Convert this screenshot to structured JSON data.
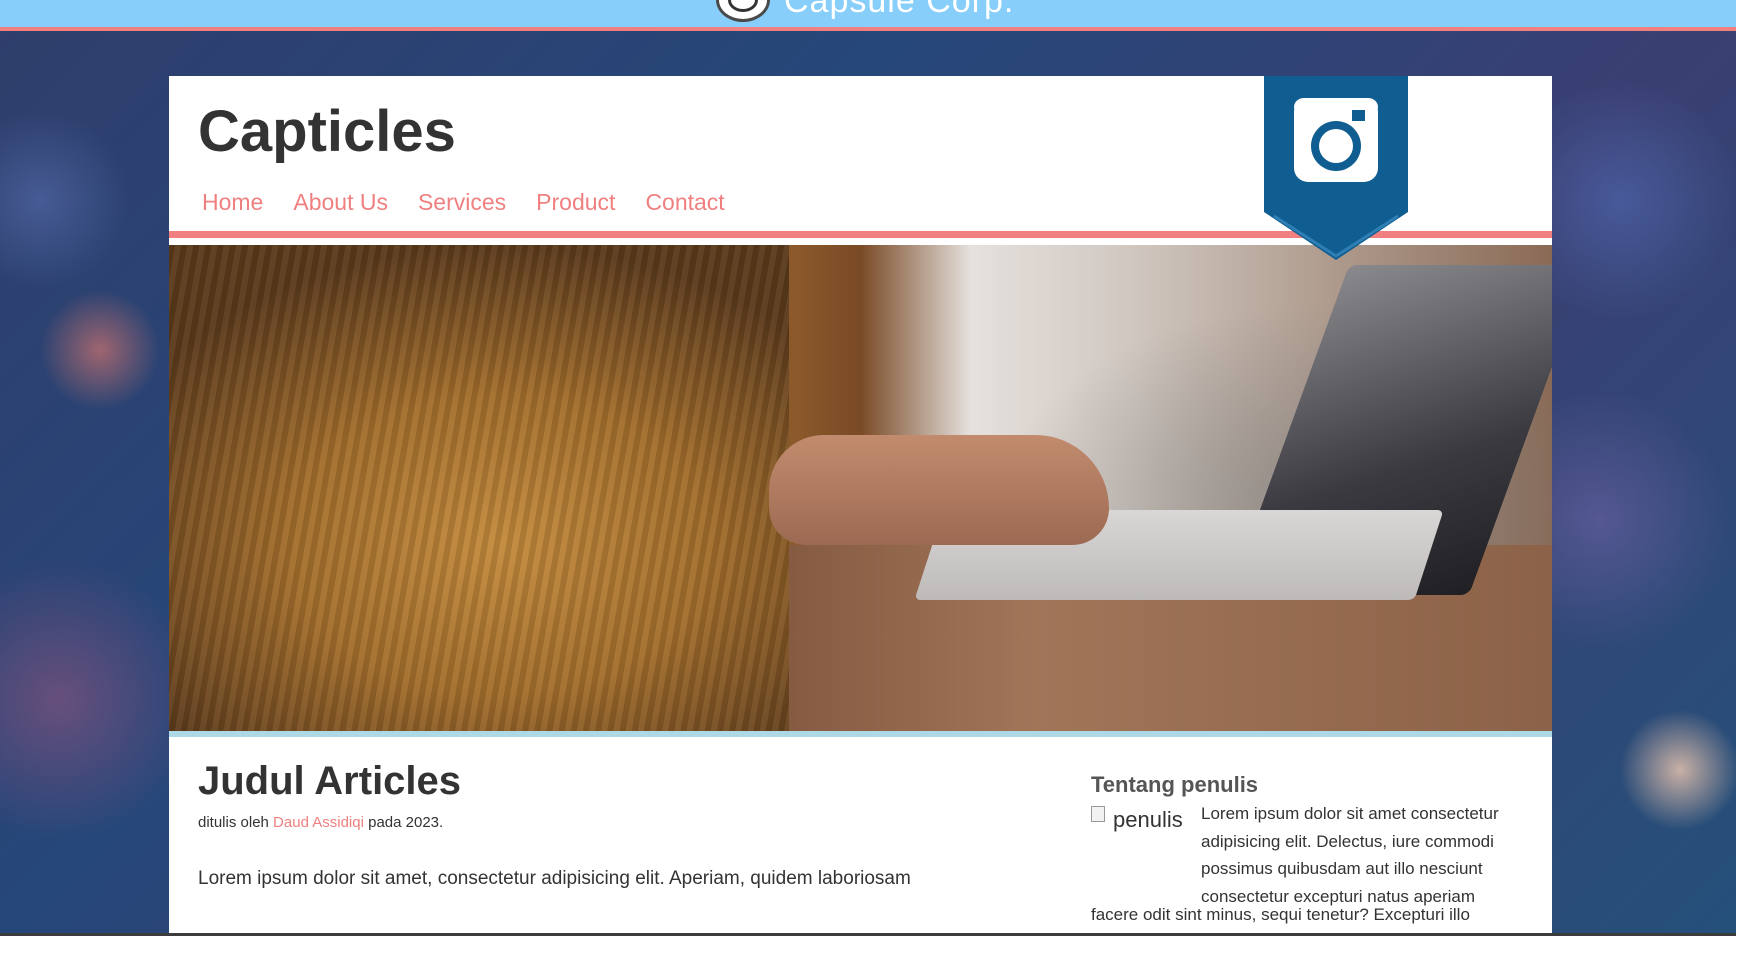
{
  "topbar": {
    "title": "Capsule Corp.",
    "logo_text": "CAPSULE CORP."
  },
  "header": {
    "brand": "Capticles",
    "nav": [
      "Home",
      "About Us",
      "Services",
      "Product",
      "Contact"
    ]
  },
  "badge": {
    "icon": "instagram-icon",
    "color": "#0f5d91"
  },
  "hero": {
    "alt": "hands typing on laptop"
  },
  "article": {
    "title": "Judul Articles",
    "byline_prefix": "ditulis oleh ",
    "author": "Daud Assidiqi",
    "byline_suffix": " pada 2023.",
    "body": "Lorem ipsum dolor sit amet, consectetur adipisicing elit. Aperiam, quidem laboriosam"
  },
  "aside": {
    "title": "Tentang penulis",
    "image_alt": "penulis",
    "text": "Lorem ipsum dolor sit amet consectetur adipisicing elit. Delectus, iure commodi possimus quibusdam aut illo nesciunt consectetur excepturi natus aperiam",
    "text_tail": "facere odit sint minus, sequi tenetur? Excepturi illo"
  },
  "colors": {
    "topbar": "#87cefa",
    "accent": "#f08080",
    "hero_rule": "#add8e6",
    "badge": "#0f5d91"
  }
}
